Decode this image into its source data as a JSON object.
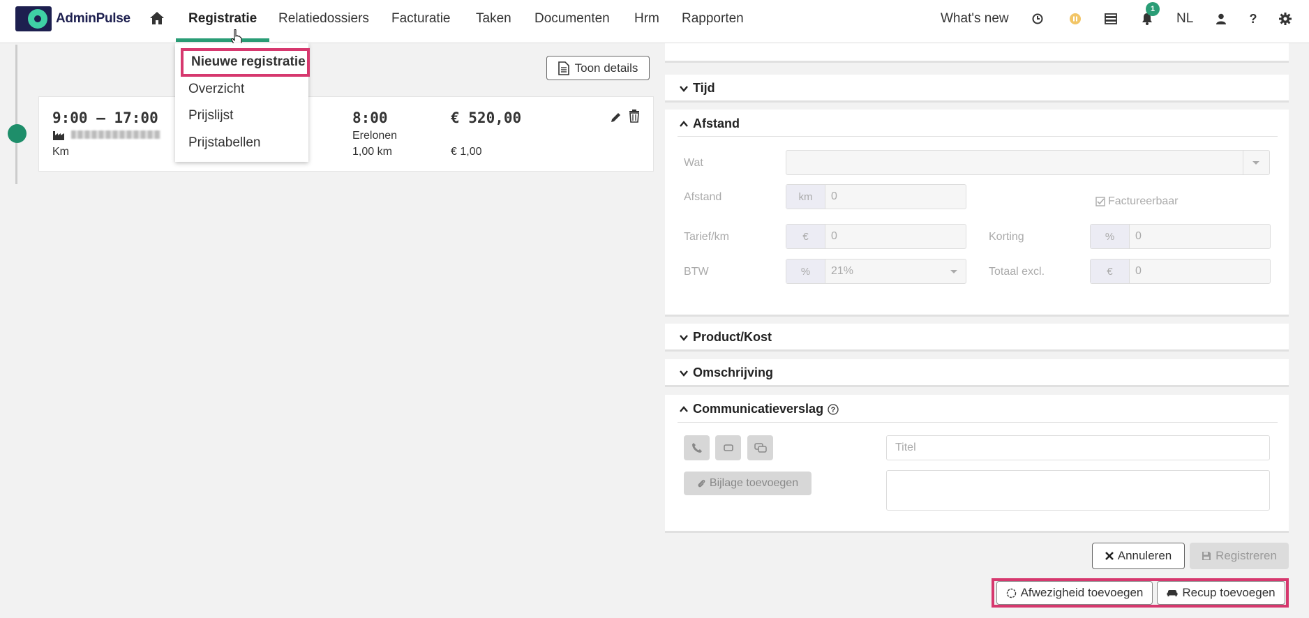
{
  "brand": {
    "name": "AdminPulse"
  },
  "nav": {
    "items": [
      "Registratie",
      "Relatiedossiers",
      "Facturatie",
      "Taken",
      "Documenten",
      "Hrm",
      "Rapporten"
    ],
    "whats_new": "What's new",
    "notification_count": "1",
    "language": "NL"
  },
  "dropdown": {
    "items": [
      "Nieuwe registratie",
      "Overzicht",
      "Prijslijst",
      "Prijstabellen"
    ]
  },
  "toolbar": {
    "details_label": "Toon details"
  },
  "entry": {
    "time_range": "9:00 – 17:00",
    "type": "Km",
    "duration": "8:00",
    "category": "Erelonen",
    "distance": "1,00 km",
    "amount": "€ 520,00",
    "unit_price": "€ 1,00"
  },
  "sections": {
    "tijd": "Tijd",
    "afstand": "Afstand",
    "product": "Product/Kost",
    "omschrijving": "Omschrijving",
    "comm": "Communicatieverslag"
  },
  "afstand_form": {
    "wat_label": "Wat",
    "afstand_label": "Afstand",
    "afstand_unit": "km",
    "afstand_value": "0",
    "factureerbaar": "Factureerbaar",
    "tarief_label": "Tarief/km",
    "tarief_unit": "€",
    "tarief_value": "0",
    "korting_label": "Korting",
    "korting_unit": "%",
    "korting_value": "0",
    "btw_label": "BTW",
    "btw_unit": "%",
    "btw_value": "21%",
    "totaal_label": "Totaal excl.",
    "totaal_unit": "€",
    "totaal_value": "0"
  },
  "comm_form": {
    "titel_placeholder": "Titel",
    "attach_label": "Bijlage toevoegen"
  },
  "actions": {
    "cancel": "Annuleren",
    "save": "Registreren",
    "absence": "Afwezigheid toevoegen",
    "recup": "Recup toevoegen"
  },
  "colors": {
    "accent": "#2a9d76",
    "highlight": "#d6386e",
    "brand_dark": "#1d1f4f"
  }
}
